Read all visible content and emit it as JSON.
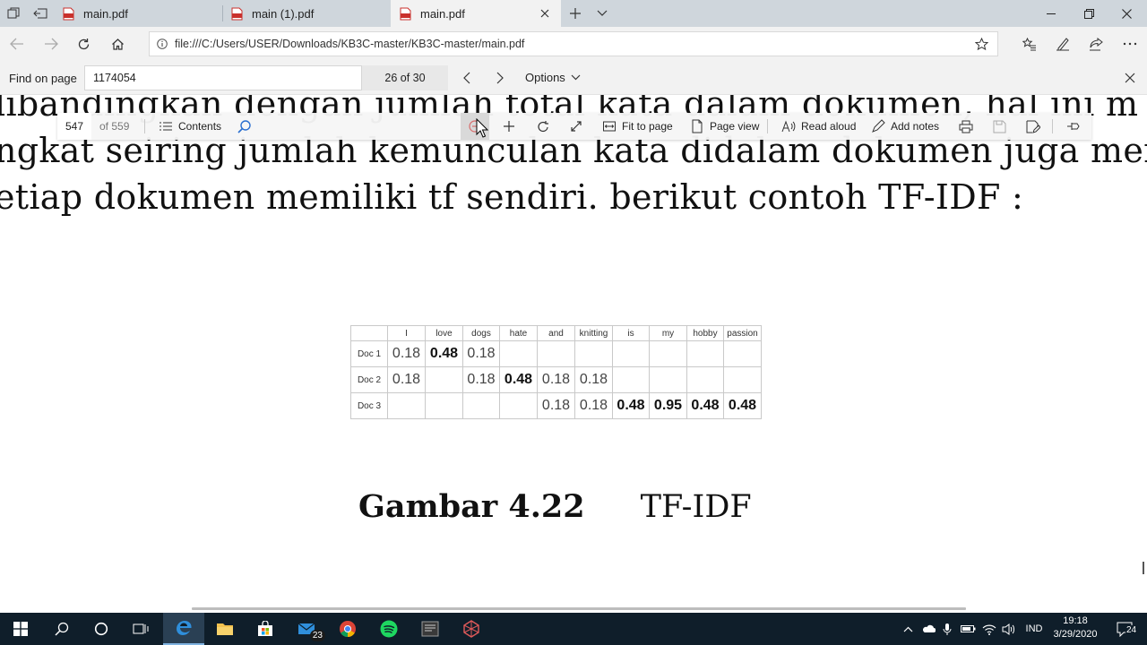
{
  "tabs": [
    {
      "title": "main.pdf"
    },
    {
      "title": "main (1).pdf"
    },
    {
      "title": "main.pdf"
    }
  ],
  "address": {
    "url": "file:///C:/Users/USER/Downloads/KB3C-master/KB3C-master/main.pdf"
  },
  "find": {
    "label": "Find on page",
    "query": "1174054",
    "count": "26 of 30",
    "options": "Options"
  },
  "pdf_toolbar": {
    "page_number": "547",
    "page_total": "of 559",
    "contents": "Contents",
    "fit_to_page": "Fit to page",
    "page_view": "Page view",
    "read_aloud": "Read aloud",
    "add_notes": "Add notes"
  },
  "document": {
    "line1": "libandingkan dengan jumlah total kata dalam dokumen, hal ini m",
    "line2": "ngkat seiring jumlah kemunculan kata didalam dokumen juga mening",
    "line3": "etiap dokumen memiliki tf sendiri.  berikut contoh TF-IDF :",
    "table": {
      "headers": [
        "",
        "I",
        "love",
        "dogs",
        "hate",
        "and",
        "knitting",
        "is",
        "my",
        "hobby",
        "passion"
      ],
      "rows": [
        {
          "label": "Doc 1",
          "cells": [
            "0.18",
            "0.48",
            "0.18",
            "",
            "",
            "",
            "",
            "",
            "",
            ""
          ]
        },
        {
          "label": "Doc 2",
          "cells": [
            "0.18",
            "",
            "0.18",
            "0.48",
            "0.18",
            "0.18",
            "",
            "",
            "",
            ""
          ]
        },
        {
          "label": "Doc 3",
          "cells": [
            "",
            "",
            "",
            "",
            "0.18",
            "0.18",
            "0.48",
            "0.95",
            "0.48",
            "0.48"
          ]
        }
      ]
    },
    "caption_label": "Gambar 4.22",
    "caption_text": "TF-IDF"
  },
  "taskbar": {
    "mail_badge": "23",
    "language": "IND",
    "time": "19:18",
    "date": "3/29/2020",
    "notification_count": "24"
  }
}
